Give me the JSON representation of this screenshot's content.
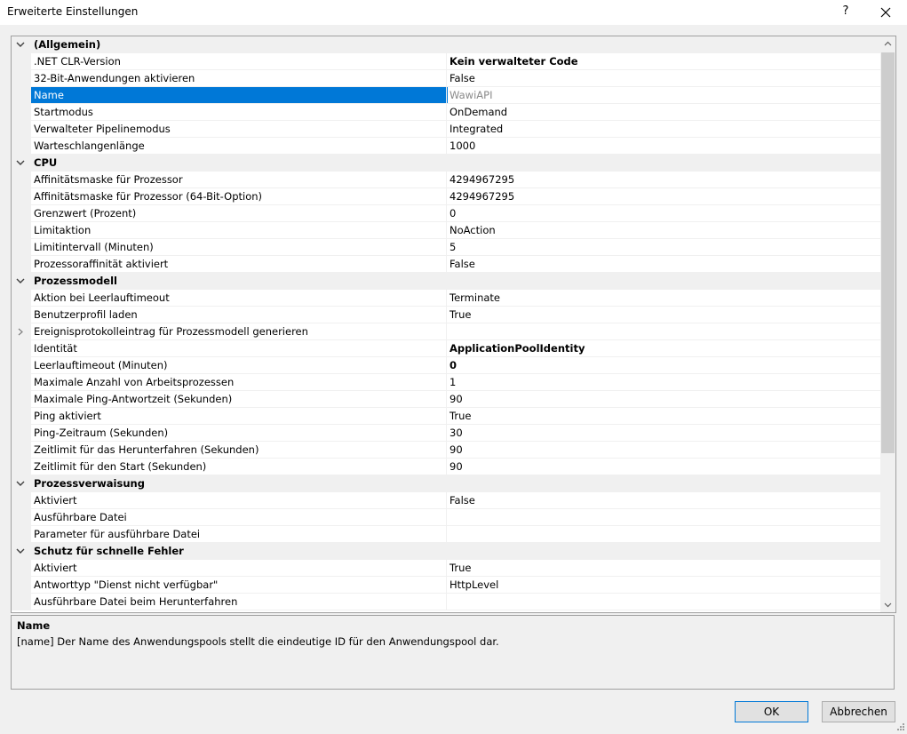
{
  "window": {
    "title": "Erweiterte Einstellungen",
    "help_label": "?"
  },
  "grid": {
    "rows": [
      {
        "type": "category",
        "label": "(Allgemein)",
        "expanded": true
      },
      {
        "type": "property",
        "name": ".NET CLR-Version",
        "value": "Kein verwalteter Code",
        "bold": true
      },
      {
        "type": "property",
        "name": "32-Bit-Anwendungen aktivieren",
        "value": "False"
      },
      {
        "type": "property",
        "name": "Name",
        "value": "WawiAPI",
        "selected": true,
        "readonly": true
      },
      {
        "type": "property",
        "name": "Startmodus",
        "value": "OnDemand"
      },
      {
        "type": "property",
        "name": "Verwalteter Pipelinemodus",
        "value": "Integrated"
      },
      {
        "type": "property",
        "name": "Warteschlangenlänge",
        "value": "1000"
      },
      {
        "type": "category",
        "label": "CPU",
        "expanded": true
      },
      {
        "type": "property",
        "name": "Affinitätsmaske für Prozessor",
        "value": "4294967295"
      },
      {
        "type": "property",
        "name": "Affinitätsmaske für Prozessor (64-Bit-Option)",
        "value": "4294967295"
      },
      {
        "type": "property",
        "name": "Grenzwert (Prozent)",
        "value": "0"
      },
      {
        "type": "property",
        "name": "Limitaktion",
        "value": "NoAction"
      },
      {
        "type": "property",
        "name": "Limitintervall (Minuten)",
        "value": "5"
      },
      {
        "type": "property",
        "name": "Prozessoraffinität aktiviert",
        "value": "False"
      },
      {
        "type": "category",
        "label": "Prozessmodell",
        "expanded": true
      },
      {
        "type": "property",
        "name": "Aktion bei Leerlauftimeout",
        "value": "Terminate"
      },
      {
        "type": "property",
        "name": "Benutzerprofil laden",
        "value": "True"
      },
      {
        "type": "property",
        "name": "Ereignisprotokolleintrag für Prozessmodell generieren",
        "value": "",
        "expandable": true
      },
      {
        "type": "property",
        "name": "Identität",
        "value": "ApplicationPoolIdentity",
        "bold": true
      },
      {
        "type": "property",
        "name": "Leerlauftimeout (Minuten)",
        "value": "0",
        "bold": true
      },
      {
        "type": "property",
        "name": "Maximale Anzahl von Arbeitsprozessen",
        "value": "1"
      },
      {
        "type": "property",
        "name": "Maximale Ping-Antwortzeit (Sekunden)",
        "value": "90"
      },
      {
        "type": "property",
        "name": "Ping aktiviert",
        "value": "True"
      },
      {
        "type": "property",
        "name": "Ping-Zeitraum (Sekunden)",
        "value": "30"
      },
      {
        "type": "property",
        "name": "Zeitlimit für das Herunterfahren (Sekunden)",
        "value": "90"
      },
      {
        "type": "property",
        "name": "Zeitlimit für den Start (Sekunden)",
        "value": "90"
      },
      {
        "type": "category",
        "label": "Prozessverwaisung",
        "expanded": true
      },
      {
        "type": "property",
        "name": "Aktiviert",
        "value": "False"
      },
      {
        "type": "property",
        "name": "Ausführbare Datei",
        "value": ""
      },
      {
        "type": "property",
        "name": "Parameter für ausführbare Datei",
        "value": ""
      },
      {
        "type": "category",
        "label": "Schutz für schnelle Fehler",
        "expanded": true
      },
      {
        "type": "property",
        "name": "Aktiviert",
        "value": "True"
      },
      {
        "type": "property",
        "name": "Antworttyp \"Dienst nicht verfügbar\"",
        "value": "HttpLevel"
      },
      {
        "type": "property",
        "name": "Ausführbare Datei beim Herunterfahren",
        "value": ""
      }
    ]
  },
  "description": {
    "title": "Name",
    "text": "[name] Der Name des Anwendungspools stellt die eindeutige ID für den Anwendungspool dar."
  },
  "buttons": {
    "ok_label": "OK",
    "cancel_label": "Abbrechen"
  },
  "colors": {
    "selection": "#0078d7",
    "category_bg": "#f0f0f0",
    "dialog_bg": "#f0f0f0"
  }
}
